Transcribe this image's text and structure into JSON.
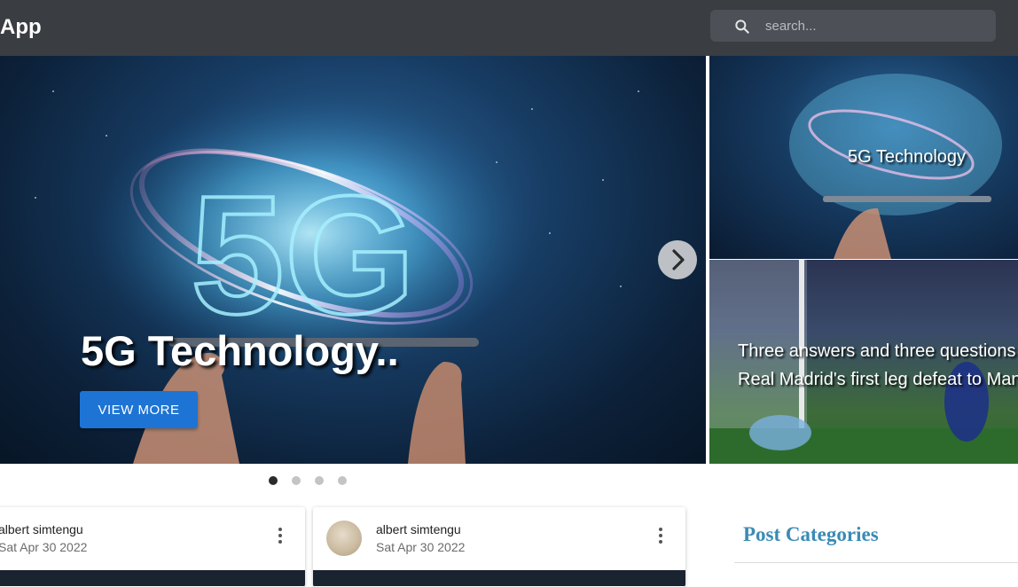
{
  "app": {
    "title": "App"
  },
  "search": {
    "placeholder": "search...",
    "icon": "search-icon"
  },
  "hero": {
    "title": "5G Technology..",
    "button_label": "VIEW MORE",
    "next_icon": "chevron-right-icon",
    "slides": 4,
    "active_slide": 1
  },
  "side_cards": [
    {
      "title": "5G Technology"
    },
    {
      "title_line1": "Three answers and three questions",
      "title_line2": "Real Madrid's first leg defeat to Man"
    }
  ],
  "posts": [
    {
      "author": "albert simtengu",
      "date": "Sat Apr 30 2022"
    },
    {
      "author": "albert simtengu",
      "date": "Sat Apr 30 2022"
    }
  ],
  "sidebar": {
    "categories_title": "Post Categories"
  },
  "colors": {
    "topbar": "#3a3d42",
    "accent_button": "#1e74d4",
    "categories_title": "#3a8bb5"
  }
}
